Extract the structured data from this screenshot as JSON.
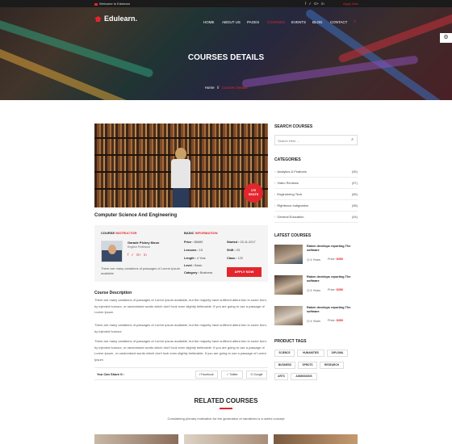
{
  "topbar": {
    "welcome": "Welcome to Edulearn",
    "social_icons": [
      "facebook-icon",
      "twitter-icon",
      "google-plus-icon",
      "linkedin-icon"
    ],
    "apply": "Apply Now"
  },
  "brand": {
    "name": "Edulearn."
  },
  "nav": {
    "items": [
      "HOME",
      "ABOUT US",
      "PAGES",
      "COURSES",
      "EVENTS",
      "BLOG",
      "CONTACT"
    ],
    "active": "COURSES"
  },
  "hero": {
    "title": "COURSES DETAILS",
    "breadcrumb_home": "Home",
    "breadcrumb_sep": "//",
    "breadcrumb_current": "Courses Details"
  },
  "course": {
    "seats_count": "170",
    "seats_label": "SEATS",
    "title": "Computer Science And Engineering",
    "instructor_heading_1": "COURSE",
    "instructor_heading_2": "INSTRUCTOR",
    "instructor_name": "Garade Pickey Moon",
    "instructor_role": "English Professor",
    "instructor_desc": "There are many variations of passages of Lorem Ipsum available",
    "basic_heading_1": "BASIC",
    "basic_heading_2": "INFORMATION",
    "price_label": "Price :",
    "price": "$6689",
    "started_label": "Started :",
    "started": "03-11-2017",
    "lessons_label": "Lessons :",
    "lessons": "15",
    "shift_label": "Shift :",
    "shift": "03",
    "length_label": "Length :",
    "length": "4 Year",
    "class_label": "Class :",
    "class": "120",
    "level_label": "Level :",
    "level": "Basic",
    "category_label": "Category :",
    "category": "Business",
    "apply_button": "APPLY NOW",
    "description_title": "Course Description",
    "paragraphs": [
      "There are many variations of passages of Lorem Ipsum available, but the majority have suffered altera tion in some form, by injected humour, or randomised words which don't look even slightly believable. If you are going to use a passage of Lorem Ipsum",
      "There are many variations of passages of Lorem Ipsum available, but the majority have suffered altera tion in some form, by injected humour",
      "There are many variations of passages of Lorem Ipsum available, but the majority have suffered altera tion in some form, by injected humour, or randomised words which don't look even slightly believable. If you are going to use a passage of Lorem Ipsum, or randomised words which don't look even slightly believable. If you are going to use a passage of Lorem Ipsum"
    ],
    "share_label": "You Can Share It :",
    "share_buttons": [
      "Facebook",
      "Twitter",
      "Google"
    ]
  },
  "related": {
    "title": "RELATED COURSES",
    "subtitle": "Considering primary motivation for the generation of narratives is a useful concept"
  },
  "sidebar": {
    "search_title": "SEARCH COURSES",
    "search_placeholder": "Search Here ...",
    "categories_title": "CATEGORIES",
    "categories": [
      {
        "name": "Analytics & Features",
        "count": "(55)"
      },
      {
        "name": "Video Reviews",
        "count": "(57)"
      },
      {
        "name": "Engineering Tech",
        "count": "(85)"
      },
      {
        "name": "Righteous Indignation",
        "count": "(58)"
      },
      {
        "name": "General Education",
        "count": "(54)"
      }
    ],
    "latest_title": "LATEST COURSES",
    "latest": [
      {
        "title": "Raken develops reporting The software",
        "years": "4 Years",
        "price_label": "Price:",
        "price": "$350"
      },
      {
        "title": "Raken develops reporting The software",
        "years": "4 Years",
        "price_label": "Price:",
        "price": "$350"
      },
      {
        "title": "Raken develops reporting The software",
        "years": "4 Years",
        "price_label": "Price:",
        "price": "$350"
      }
    ],
    "tags_title": "PRODUCT TAGS",
    "tags": [
      "SCIENCE",
      "HUMANITIES",
      "DIPLOMA",
      "BUSINESS",
      "SPROTS",
      "RESEARCH",
      "ARTS",
      "ADMISSIONS"
    ]
  }
}
